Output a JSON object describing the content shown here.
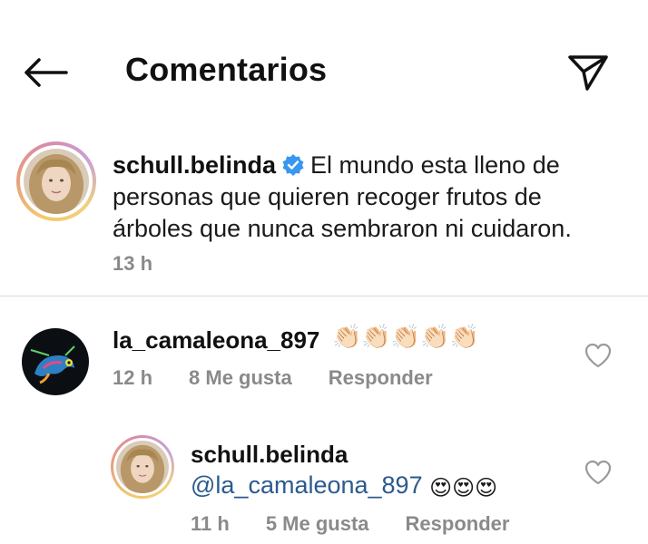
{
  "header": {
    "title": "Comentarios",
    "back_icon": "arrow-left-icon",
    "send_icon": "paper-plane-icon"
  },
  "caption": {
    "username": "schull.belinda",
    "verified": true,
    "text": "El mundo esta lleno de personas que quieren recoger frutos de árboles que nunca sembraron ni cuidaron.",
    "time": "13 h"
  },
  "comments": [
    {
      "username": "la_camaleona_897",
      "emoji": "👏🏻👏🏻👏🏻👏🏻👏🏻",
      "time": "12 h",
      "likes": "8 Me gusta",
      "reply_label": "Responder",
      "replies": [
        {
          "username": "schull.belinda",
          "mention": "@la_camaleona_897",
          "emoji": "😍😍😍",
          "time": "11 h",
          "likes": "5 Me gusta",
          "reply_label": "Responder"
        }
      ]
    }
  ],
  "colors": {
    "text": "#111111",
    "meta": "#8a8a8a",
    "mention": "#2c5a8f",
    "verified": "#3897f0",
    "divider": "#d9d9d9"
  }
}
